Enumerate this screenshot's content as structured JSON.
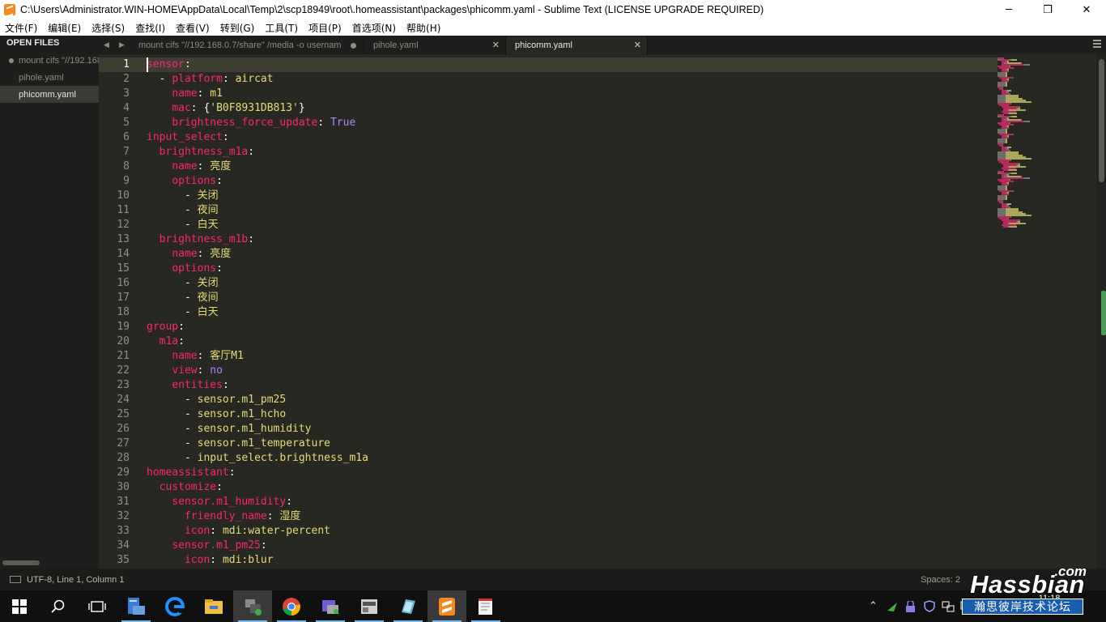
{
  "window": {
    "title": "C:\\Users\\Administrator.WIN-HOME\\AppData\\Local\\Temp\\2\\scp18949\\root\\.homeassistant\\packages\\phicomm.yaml - Sublime Text (LICENSE UPGRADE REQUIRED)",
    "minimize": "─",
    "maximize": "❐",
    "close": "✕"
  },
  "menu": [
    "文件(F)",
    "编辑(E)",
    "选择(S)",
    "查找(I)",
    "查看(V)",
    "转到(G)",
    "工具(T)",
    "项目(P)",
    "首选项(N)",
    "帮助(H)"
  ],
  "sidebar": {
    "header": "OPEN FILES",
    "items": [
      {
        "label": "mount cifs \"//192.168.0.7/share\" /media -o usernam",
        "dirty": true,
        "active": false
      },
      {
        "label": "pihole.yaml",
        "dirty": false,
        "active": false
      },
      {
        "label": "phicomm.yaml",
        "dirty": false,
        "active": true
      }
    ]
  },
  "tabs": [
    {
      "label": "mount cifs \"//192.168.0.7/share\" /media -o usernam",
      "dirty": true
    },
    {
      "label": "pihole.yaml",
      "close": "✕"
    },
    {
      "label": "phicomm.yaml",
      "close": "✕"
    }
  ],
  "editor": {
    "current_line": 1,
    "lines": [
      {
        "n": "1",
        "parts": [
          [
            "k",
            "sensor"
          ],
          [
            "p",
            ":"
          ]
        ]
      },
      {
        "n": "2",
        "parts": [
          [
            "p",
            "  - "
          ],
          [
            "k",
            "platform"
          ],
          [
            "p",
            ": "
          ],
          [
            "v",
            "aircat"
          ]
        ]
      },
      {
        "n": "3",
        "parts": [
          [
            "p",
            "    "
          ],
          [
            "k",
            "name"
          ],
          [
            "p",
            ": "
          ],
          [
            "v",
            "m1"
          ]
        ]
      },
      {
        "n": "4",
        "parts": [
          [
            "p",
            "    "
          ],
          [
            "k",
            "mac"
          ],
          [
            "p",
            ": {"
          ],
          [
            "v",
            "'B0F8931DB813'"
          ],
          [
            "p",
            "}"
          ]
        ]
      },
      {
        "n": "5",
        "parts": [
          [
            "p",
            "    "
          ],
          [
            "k",
            "brightness_force_update"
          ],
          [
            "p",
            ": "
          ],
          [
            "c",
            "True"
          ]
        ]
      },
      {
        "n": "6",
        "parts": [
          [
            "k",
            "input_select"
          ],
          [
            "p",
            ":"
          ]
        ]
      },
      {
        "n": "7",
        "parts": [
          [
            "p",
            "  "
          ],
          [
            "k",
            "brightness_m1a"
          ],
          [
            "p",
            ":"
          ]
        ]
      },
      {
        "n": "8",
        "parts": [
          [
            "p",
            "    "
          ],
          [
            "k",
            "name"
          ],
          [
            "p",
            ": "
          ],
          [
            "v",
            "亮度"
          ]
        ]
      },
      {
        "n": "9",
        "parts": [
          [
            "p",
            "    "
          ],
          [
            "k",
            "options"
          ],
          [
            "p",
            ":"
          ]
        ]
      },
      {
        "n": "10",
        "parts": [
          [
            "p",
            "      - "
          ],
          [
            "v",
            "关闭"
          ]
        ]
      },
      {
        "n": "11",
        "parts": [
          [
            "p",
            "      - "
          ],
          [
            "v",
            "夜间"
          ]
        ]
      },
      {
        "n": "12",
        "parts": [
          [
            "p",
            "      - "
          ],
          [
            "v",
            "白天"
          ]
        ]
      },
      {
        "n": "13",
        "parts": [
          [
            "p",
            "  "
          ],
          [
            "k",
            "brightness_m1b"
          ],
          [
            "p",
            ":"
          ]
        ]
      },
      {
        "n": "14",
        "parts": [
          [
            "p",
            "    "
          ],
          [
            "k",
            "name"
          ],
          [
            "p",
            ": "
          ],
          [
            "v",
            "亮度"
          ]
        ]
      },
      {
        "n": "15",
        "parts": [
          [
            "p",
            "    "
          ],
          [
            "k",
            "options"
          ],
          [
            "p",
            ":"
          ]
        ]
      },
      {
        "n": "16",
        "parts": [
          [
            "p",
            "      - "
          ],
          [
            "v",
            "关闭"
          ]
        ]
      },
      {
        "n": "17",
        "parts": [
          [
            "p",
            "      - "
          ],
          [
            "v",
            "夜间"
          ]
        ]
      },
      {
        "n": "18",
        "parts": [
          [
            "p",
            "      - "
          ],
          [
            "v",
            "白天"
          ]
        ]
      },
      {
        "n": "19",
        "parts": [
          [
            "k",
            "group"
          ],
          [
            "p",
            ":"
          ]
        ]
      },
      {
        "n": "20",
        "parts": [
          [
            "p",
            "  "
          ],
          [
            "k",
            "m1a"
          ],
          [
            "p",
            ":"
          ]
        ]
      },
      {
        "n": "21",
        "parts": [
          [
            "p",
            "    "
          ],
          [
            "k",
            "name"
          ],
          [
            "p",
            ": "
          ],
          [
            "v",
            "客厅M1"
          ]
        ]
      },
      {
        "n": "22",
        "parts": [
          [
            "p",
            "    "
          ],
          [
            "k",
            "view"
          ],
          [
            "p",
            ": "
          ],
          [
            "c",
            "no"
          ]
        ]
      },
      {
        "n": "23",
        "parts": [
          [
            "p",
            "    "
          ],
          [
            "k",
            "entities"
          ],
          [
            "p",
            ":"
          ]
        ]
      },
      {
        "n": "24",
        "parts": [
          [
            "p",
            "      - "
          ],
          [
            "v",
            "sensor.m1_pm25"
          ]
        ]
      },
      {
        "n": "25",
        "parts": [
          [
            "p",
            "      - "
          ],
          [
            "v",
            "sensor.m1_hcho"
          ]
        ]
      },
      {
        "n": "26",
        "parts": [
          [
            "p",
            "      - "
          ],
          [
            "v",
            "sensor.m1_humidity"
          ]
        ]
      },
      {
        "n": "27",
        "parts": [
          [
            "p",
            "      - "
          ],
          [
            "v",
            "sensor.m1_temperature"
          ]
        ]
      },
      {
        "n": "28",
        "parts": [
          [
            "p",
            "      - "
          ],
          [
            "v",
            "input_select.brightness_m1a"
          ]
        ]
      },
      {
        "n": "29",
        "parts": [
          [
            "k",
            "homeassistant"
          ],
          [
            "p",
            ":"
          ]
        ]
      },
      {
        "n": "30",
        "parts": [
          [
            "p",
            "  "
          ],
          [
            "k",
            "customize"
          ],
          [
            "p",
            ":"
          ]
        ]
      },
      {
        "n": "31",
        "parts": [
          [
            "p",
            "    "
          ],
          [
            "k",
            "sensor.m1_humidity"
          ],
          [
            "p",
            ":"
          ]
        ]
      },
      {
        "n": "32",
        "parts": [
          [
            "p",
            "      "
          ],
          [
            "k",
            "friendly_name"
          ],
          [
            "p",
            ": "
          ],
          [
            "v",
            "湿度"
          ]
        ]
      },
      {
        "n": "33",
        "parts": [
          [
            "p",
            "      "
          ],
          [
            "k",
            "icon"
          ],
          [
            "p",
            ": "
          ],
          [
            "v",
            "mdi:water-percent"
          ]
        ]
      },
      {
        "n": "34",
        "parts": [
          [
            "p",
            "    "
          ],
          [
            "k",
            "sensor.m1_pm25"
          ],
          [
            "p",
            ":"
          ]
        ]
      },
      {
        "n": "35",
        "parts": [
          [
            "p",
            "      "
          ],
          [
            "k",
            "icon"
          ],
          [
            "p",
            ": "
          ],
          [
            "v",
            "mdi:blur"
          ]
        ]
      }
    ]
  },
  "status": {
    "left": "UTF-8, Line 1, Column 1",
    "right": "Spaces: 2"
  },
  "clock": {
    "time": "11:18",
    "date": "2018/11/7"
  },
  "watermark": {
    "com": ".com",
    "main": "Hassbian",
    "sub": "瀚思彼岸技术论坛"
  },
  "colors": {
    "keyword": "#f92672",
    "string": "#e6db74",
    "constant": "#ae81ff",
    "background": "#272822",
    "accent": "#f58a1f"
  },
  "taskbar": {
    "apps": [
      "start-icon",
      "search-icon",
      "task-view-icon",
      "file-server-icon",
      "edge-icon",
      "file-explorer-icon",
      "network-app-icon",
      "chrome-icon",
      "remote-app-icon",
      "control-app-icon",
      "notes-app-icon",
      "sublime-text-icon",
      "notepad-icon"
    ]
  }
}
